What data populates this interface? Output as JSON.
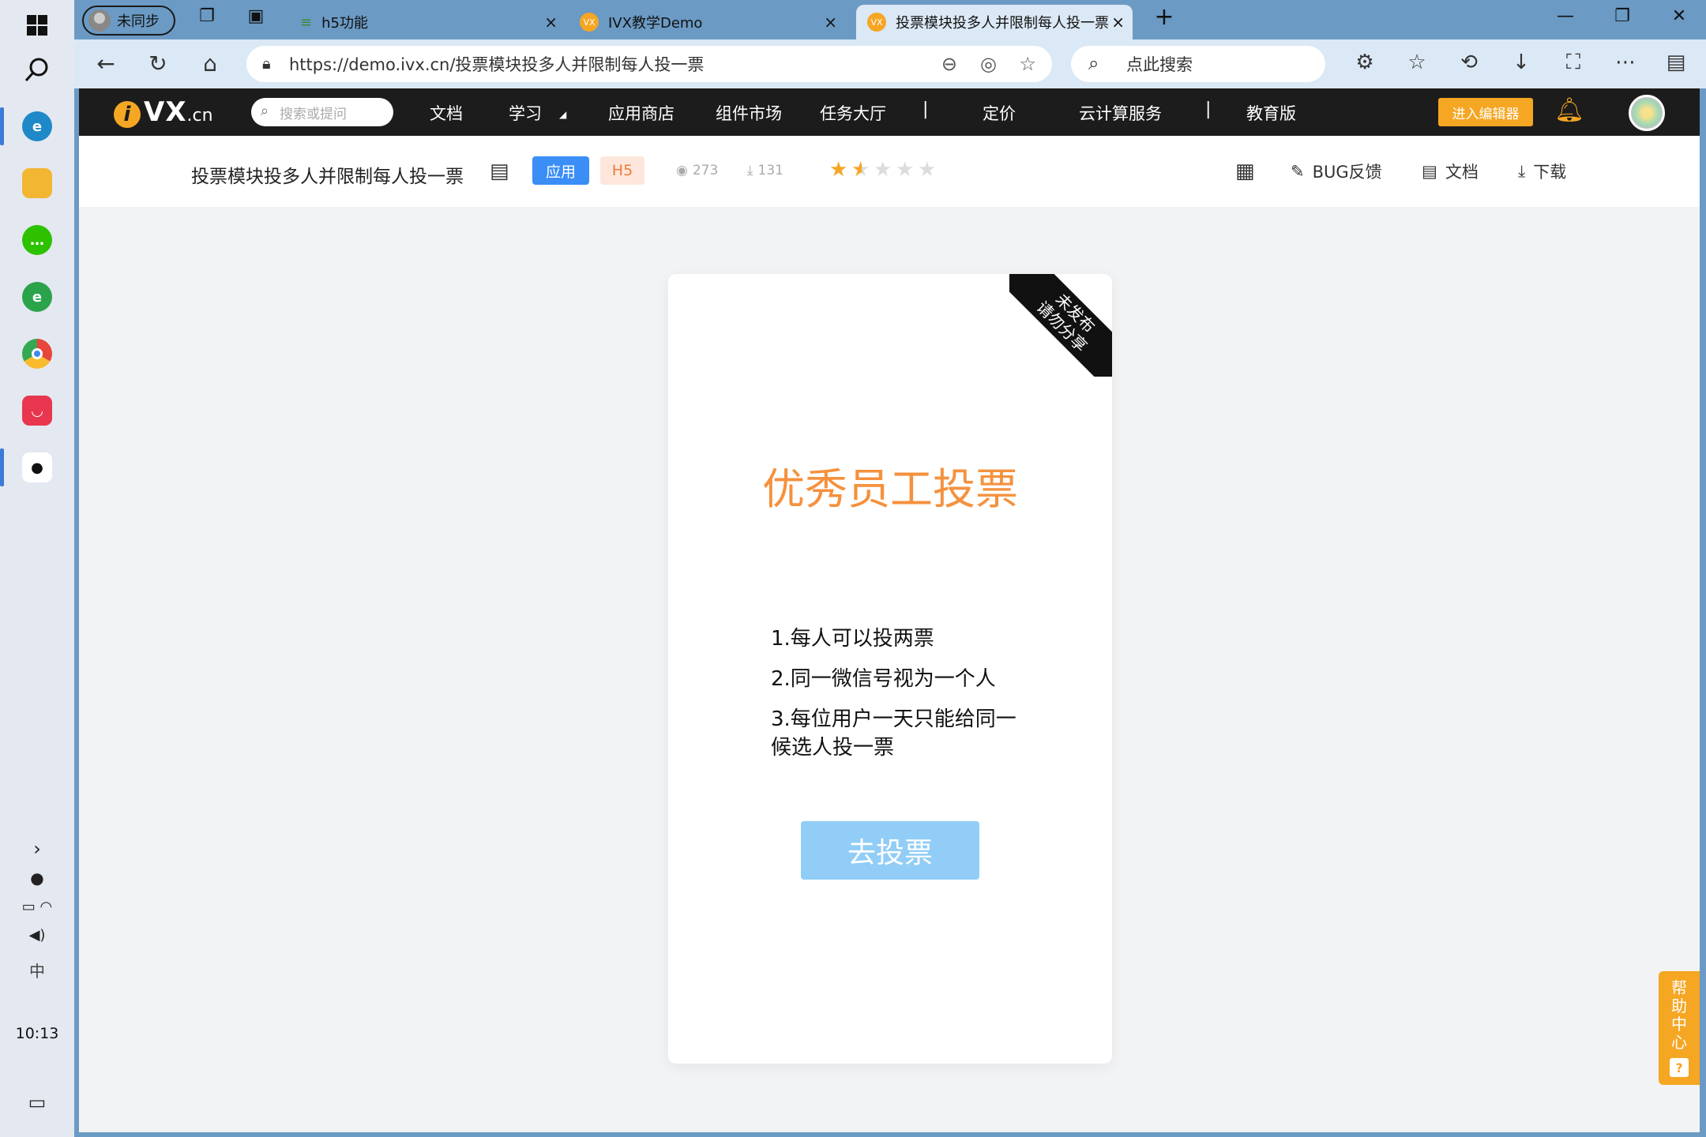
{
  "taskbar": {
    "clock": "10:13",
    "apps": [
      {
        "icon": "edge-icon",
        "color": "#1e88c9"
      },
      {
        "icon": "file-explorer-icon",
        "color": "#f2b632"
      },
      {
        "icon": "wechat-icon",
        "color": "#2dc100"
      },
      {
        "icon": "ie-icon",
        "color": "#2aa34a"
      },
      {
        "icon": "chrome-icon",
        "color": "#e8453c"
      },
      {
        "icon": "app-red-icon",
        "color": "#e8364f"
      },
      {
        "icon": "qq-icon",
        "color": "#111111"
      }
    ]
  },
  "browser": {
    "profile_label": "未同步",
    "tabs": [
      {
        "title": "h5功能"
      },
      {
        "title": "IVX教学Demo"
      },
      {
        "title": "投票模块投多人并限制每人投一票"
      }
    ],
    "url": "https://demo.ivx.cn/投票模块投多人并限制每人投一票",
    "search_placeholder": "点此搜索"
  },
  "site": {
    "logo_text": "VX",
    "logo_suffix": ".cn",
    "search_placeholder": "搜索或提问",
    "nav": [
      "文档",
      "学习",
      "应用商店",
      "组件市场",
      "任务大厅",
      "|",
      "定价",
      "云计算服务",
      "|",
      "教育版"
    ],
    "editor_button": "进入编辑器",
    "accent": "#f5a623"
  },
  "project": {
    "title": "投票模块投多人并限制每人投一票",
    "tag_app": "应用",
    "tag_h5": "H5",
    "views": "273",
    "downloads": "131",
    "rating": 1.5,
    "rating_max": 5,
    "actions": {
      "bug": "BUG反馈",
      "docs": "文档",
      "download": "下载"
    }
  },
  "card": {
    "ribbon": [
      "未发布",
      "请勿分享"
    ],
    "title": "优秀员工投票",
    "title_color": "#f5913e",
    "rules": [
      "1.每人可以投两票",
      "2.同一微信号视为一个人",
      "3.每位用户一天只能给同一候选人投一票"
    ],
    "button": "去投票",
    "button_color": "#91cdf6"
  },
  "help": {
    "label": "帮助中心",
    "icon": "?"
  }
}
